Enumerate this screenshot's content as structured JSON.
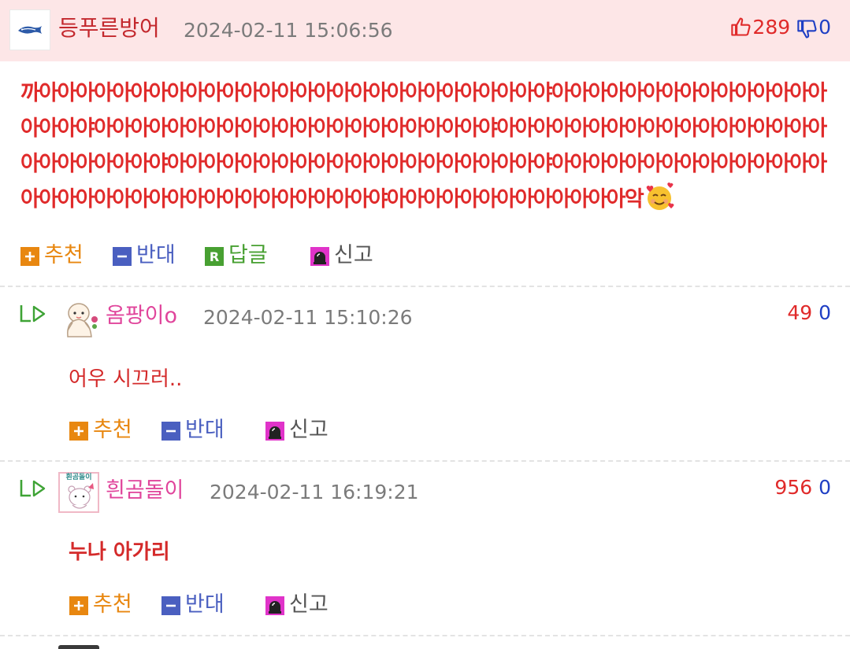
{
  "post": {
    "author": "등푸른방어",
    "timestamp": "2024-02-11 15:06:56",
    "upvotes": "289",
    "downvotes": "0",
    "content": "까아아아아아아아아아아아아아아아아아아아아아아아아아아아야아아아아아아아아아아아아아아아아아아야아아아아아아아아아아아아아아아아아아아아아야아아아아아아아아아아아아아아아아아아아아아아아아아야아아아아아아아아아아아아아아아아아아아아야아아아아아아아아아아아아아아아아아아아아아아아아아아아아아아아아아아야아아아아아아아아아아아아아악",
    "emoji": "smiling-face-with-hearts",
    "actions": {
      "recommend": "추천",
      "oppose": "반대",
      "reply": "답글",
      "report": "신고"
    }
  },
  "comments": [
    {
      "author": "옴팡이o",
      "timestamp": "2024-02-11 15:10:26",
      "upvotes": "49",
      "downvotes": "0",
      "text": "어우 시끄러..",
      "bold": false,
      "avatar_caption": "",
      "actions": {
        "recommend": "추천",
        "oppose": "반대",
        "report": "신고"
      }
    },
    {
      "author": "흰곰돌이",
      "timestamp": "2024-02-11 16:19:21",
      "upvotes": "956",
      "downvotes": "0",
      "text": "누나 아가리",
      "bold": true,
      "avatar_caption": "흰곰돌이",
      "actions": {
        "recommend": "추천",
        "oppose": "반대",
        "report": "신고"
      }
    }
  ],
  "colors": {
    "header_bg": "#fde6e7",
    "vote_red": "#e02a2a",
    "vote_blue": "#1f3fc4",
    "author_main": "#c3282d",
    "author_comment": "#e0449b",
    "recommend": "#e88710",
    "oppose": "#4a5fc0",
    "reply": "#48a032",
    "report": "#555555",
    "reply_arrow": "#3ea335"
  },
  "icons": {
    "post_avatar": "fish-icon",
    "upvote": "thumbs-up-icon",
    "downvote": "thumbs-down-icon",
    "recommend": "plus-icon",
    "oppose": "minus-icon",
    "reply": "reply-r-icon",
    "report": "siren-icon",
    "comment_indicator": "reply-arrow-icon"
  }
}
